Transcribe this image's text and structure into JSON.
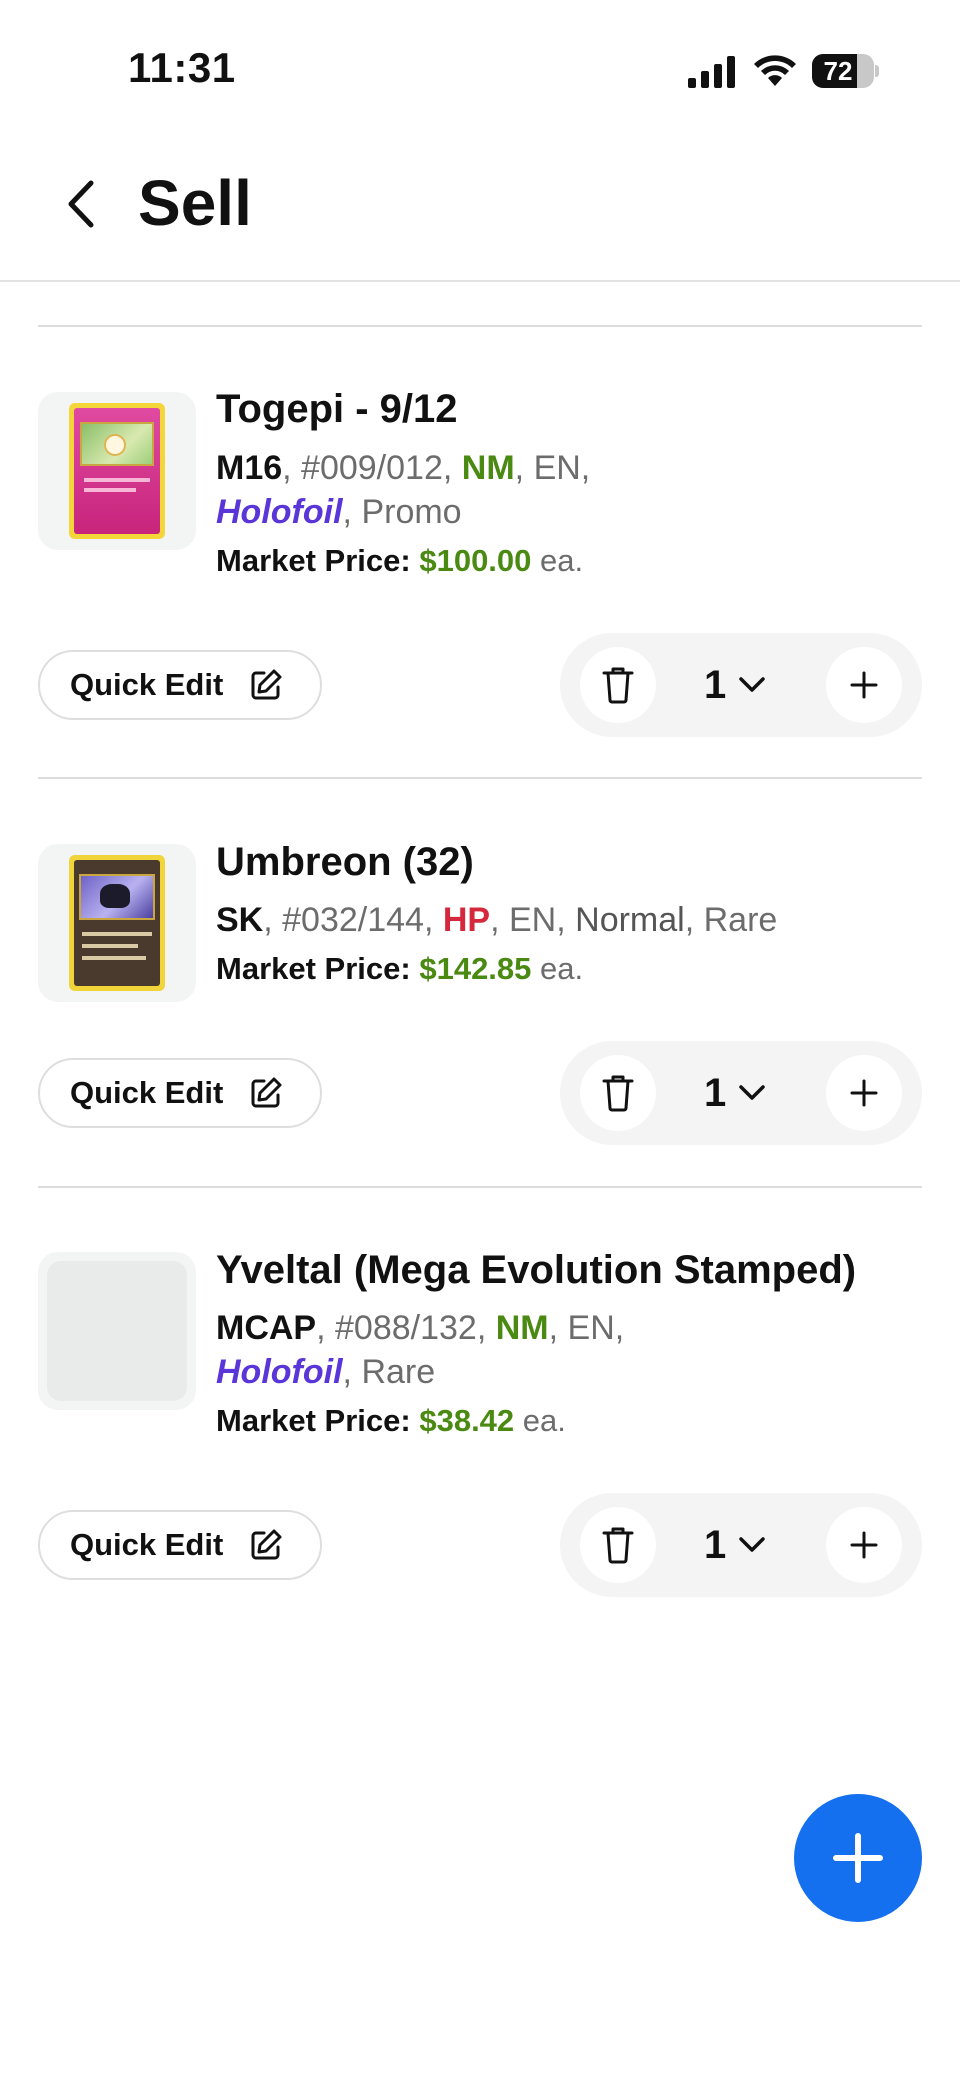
{
  "status_bar": {
    "time": "11:31",
    "battery_level": 72,
    "battery_text": "72",
    "icons": [
      "signal-icon",
      "wifi-icon",
      "battery-icon"
    ]
  },
  "header": {
    "title": "Sell",
    "back_icon": "chevron-left-icon"
  },
  "items": [
    {
      "name": "Togepi - 9/12",
      "set": "M16",
      "number": "#009/012",
      "condition": "NM",
      "language": "EN",
      "printing": "Holofoil",
      "rarity": "Promo",
      "price_label": "Market Price:",
      "price": "$100.00",
      "price_suffix": "ea.",
      "quick_edit_label": "Quick Edit",
      "quantity": "1"
    },
    {
      "name": "Umbreon (32)",
      "set": "SK",
      "number": "#032/144",
      "condition": "HP",
      "language": "EN",
      "printing": "Normal",
      "rarity": "Rare",
      "price_label": "Market Price:",
      "price": "$142.85",
      "price_suffix": "ea.",
      "quick_edit_label": "Quick Edit",
      "quantity": "1"
    },
    {
      "name": "Yveltal (Mega Evolution Stamped)",
      "set": "MCAP",
      "number": "#088/132",
      "condition": "NM",
      "language": "EN",
      "printing": "Holofoil",
      "rarity": "Rare",
      "price_label": "Market Price:",
      "price": "$38.42",
      "price_suffix": "ea.",
      "quick_edit_label": "Quick Edit",
      "quantity": "1"
    }
  ],
  "separators": {
    "comma": ", "
  },
  "colors": {
    "accent_blue": "#1570ef",
    "condition_good": "#4a8a12",
    "condition_poor": "#d6283c",
    "holofoil": "#5a36d8",
    "price": "#4a8a12"
  }
}
